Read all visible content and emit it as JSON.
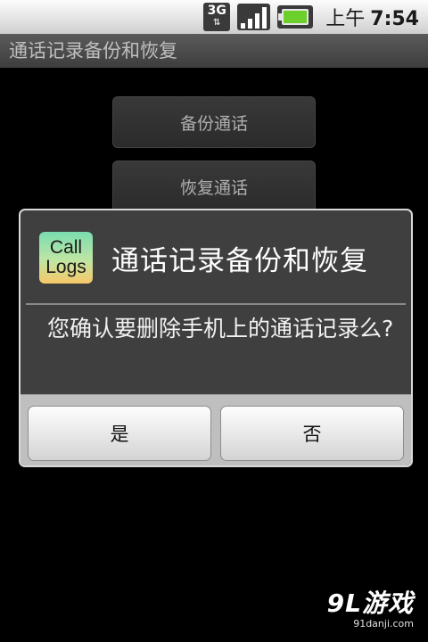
{
  "status_bar": {
    "network": "3G",
    "time_prefix": "上午",
    "time": "7:54",
    "icons": [
      "network-3g-icon",
      "signal-icon",
      "battery-charging-icon"
    ]
  },
  "app": {
    "title": "通话记录备份和恢复"
  },
  "main": {
    "buttons": [
      {
        "label": "备份通话"
      },
      {
        "label": "恢复通话"
      }
    ]
  },
  "dialog": {
    "icon_text_line1": "Call",
    "icon_text_line2": "Logs",
    "title": "通话记录备份和恢复",
    "message": "您确认要删除手机上的通话记录么?",
    "yes_label": "是",
    "no_label": "否"
  },
  "watermark": {
    "main": "9L游戏",
    "sub": "91danji.com"
  },
  "colors": {
    "dialog_bg": "#3f3f3f",
    "dialog_border": "#d8d8d8",
    "footer_bg": "#bfbfbf",
    "title_bar_bg": "#4a4a4a",
    "battery_green": "#6ccf2b"
  }
}
